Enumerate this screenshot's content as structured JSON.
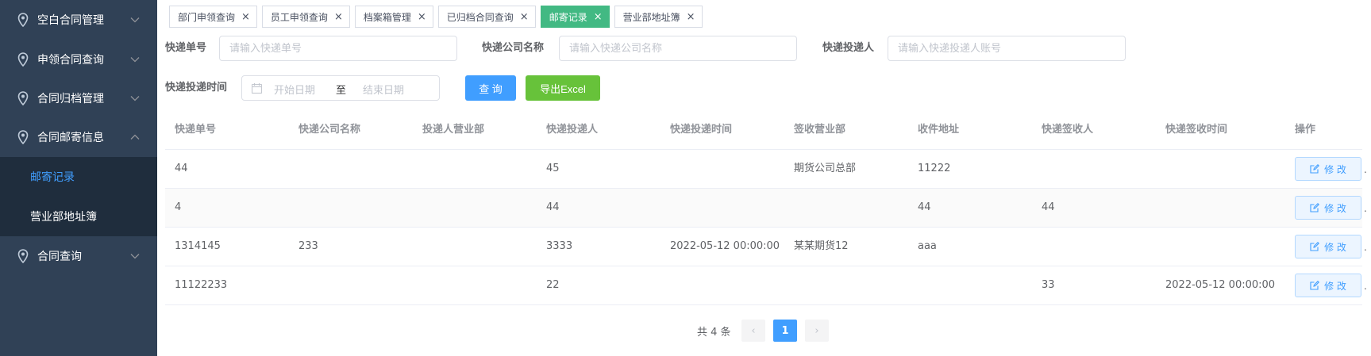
{
  "sidebar": {
    "items": [
      {
        "label": "空白合同管理",
        "icon": "location-icon",
        "chevron": "chevron-down-icon"
      },
      {
        "label": "申领合同查询",
        "icon": "location-icon",
        "chevron": "chevron-down-icon"
      },
      {
        "label": "合同归档管理",
        "icon": "location-icon",
        "chevron": "chevron-down-icon"
      },
      {
        "label": "合同邮寄信息",
        "icon": "location-icon",
        "chevron": "chevron-up-icon"
      },
      {
        "label": "合同查询",
        "icon": "location-icon",
        "chevron": "chevron-down-icon"
      }
    ],
    "submenu": [
      {
        "label": "邮寄记录",
        "active": true
      },
      {
        "label": "营业部地址簿",
        "active": false
      }
    ]
  },
  "tags": [
    {
      "label": "部门申领查询",
      "active": false
    },
    {
      "label": "员工申领查询",
      "active": false
    },
    {
      "label": "档案箱管理",
      "active": false
    },
    {
      "label": "已归档合同查询",
      "active": false
    },
    {
      "label": "邮寄记录",
      "active": true
    },
    {
      "label": "营业部地址簿",
      "active": false
    }
  ],
  "filters": {
    "tracking_no_label": "快递单号",
    "tracking_no_placeholder": "请输入快递单号",
    "company_label": "快递公司名称",
    "company_placeholder": "请输入快递公司名称",
    "sender_label": "快递投递人",
    "sender_placeholder": "请输入快递投递人账号",
    "time_label": "快递投递时间",
    "start_placeholder": "开始日期",
    "range_separator": "至",
    "end_placeholder": "结束日期",
    "query_label": "查 询",
    "export_label": "导出Excel"
  },
  "table": {
    "headers": [
      "快递单号",
      "快递公司名称",
      "投递人营业部",
      "快递投递人",
      "快递投递时间",
      "签收营业部",
      "收件地址",
      "快递签收人",
      "快递签收时间",
      "操作"
    ],
    "rows": [
      [
        "44",
        "",
        "",
        "45",
        "",
        "期货公司总部",
        "11222",
        "",
        ""
      ],
      [
        "4",
        "",
        "",
        "44",
        "",
        "",
        "44",
        "44",
        ""
      ],
      [
        "1314145",
        "233",
        "",
        "3333",
        "2022-05-12 00:00:00",
        "某某期货12",
        "aaa",
        "",
        ""
      ],
      [
        "11122233",
        "",
        "",
        "22",
        "",
        "",
        "",
        "33",
        "2022-05-12 00:00:00"
      ]
    ],
    "edit_label": "修 改",
    "more_dot": "."
  },
  "pagination": {
    "total": "共 4 条",
    "prev": "‹",
    "current": "1",
    "next": "›"
  },
  "colors": {
    "sidebar_bg": "#304156",
    "submenu_bg": "#1f2d3d",
    "primary": "#409eff",
    "success": "#67c23a",
    "active_tag": "#42b983"
  }
}
